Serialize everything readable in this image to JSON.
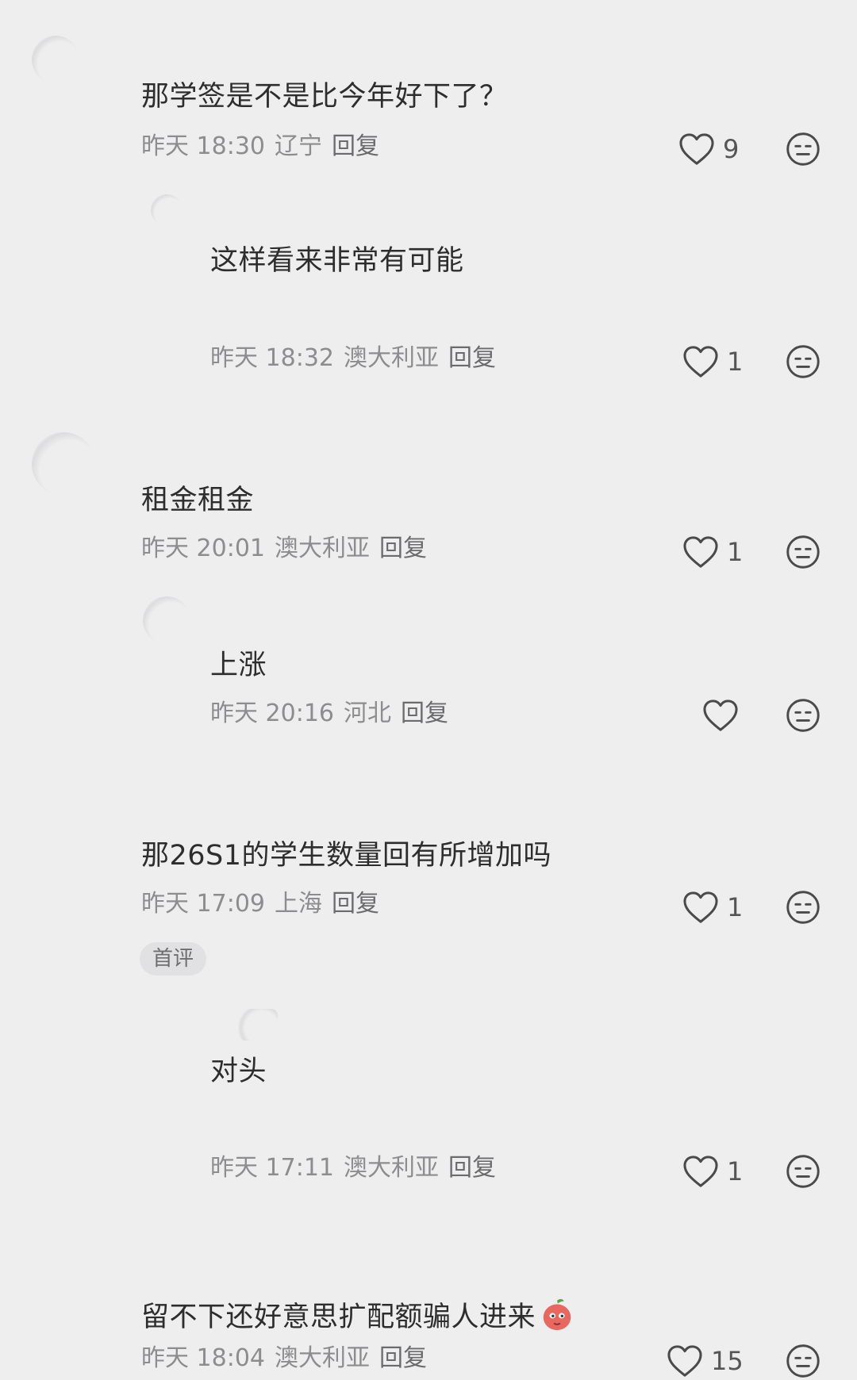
{
  "comments": [
    {
      "text": "那学签是不是比今年好下了？",
      "time": "昨天 18:30",
      "location": "辽宁",
      "reply_label": "回复",
      "likes": "9"
    },
    {
      "text": "这样看来非常有可能",
      "time": "昨天 18:32",
      "location": "澳大利亚",
      "reply_label": "回复",
      "likes": "1"
    },
    {
      "text": "租金租金",
      "time": "昨天 20:01",
      "location": "澳大利亚",
      "reply_label": "回复",
      "likes": "1"
    },
    {
      "text": "上涨",
      "time": "昨天 20:16",
      "location": "河北",
      "reply_label": "回复",
      "likes": ""
    },
    {
      "text": "那26S1的学生数量回有所增加吗",
      "time": "昨天 17:09",
      "location": "上海",
      "reply_label": "回复",
      "likes": "1",
      "badge": "首评"
    },
    {
      "text": "对头",
      "time": "昨天 17:11",
      "location": "澳大利亚",
      "reply_label": "回复",
      "likes": "1"
    },
    {
      "text": "留不下还好意思扩配额骗人进来",
      "time": "昨天 18:04",
      "location": "澳大利亚",
      "reply_label": "回复",
      "likes": "15",
      "emoji": "peach-emoji"
    }
  ],
  "icons": {
    "like": "heart-outline-icon",
    "dislike": "meh-face-icon"
  },
  "colors": {
    "background": "#eeeeef",
    "text": "#2d2d2d",
    "meta": "#8d8d8f",
    "icon": "#4a4a4a",
    "peach": "#e8675f"
  }
}
